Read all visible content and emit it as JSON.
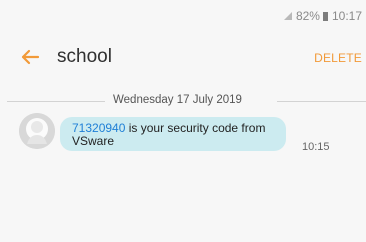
{
  "status_bar": {
    "battery": "82%",
    "time": "10:17"
  },
  "header": {
    "title": "school",
    "delete_label": "DELETE"
  },
  "conversation": {
    "date": "Wednesday 17 July 2019",
    "messages": [
      {
        "code": "71320940",
        "text_before_break": " is your security code from",
        "text_after_break": "VSware",
        "time": "10:15"
      }
    ]
  },
  "colors": {
    "accent": "#f29a39",
    "bubble": "#ccebf0",
    "link": "#1f7fd6"
  }
}
